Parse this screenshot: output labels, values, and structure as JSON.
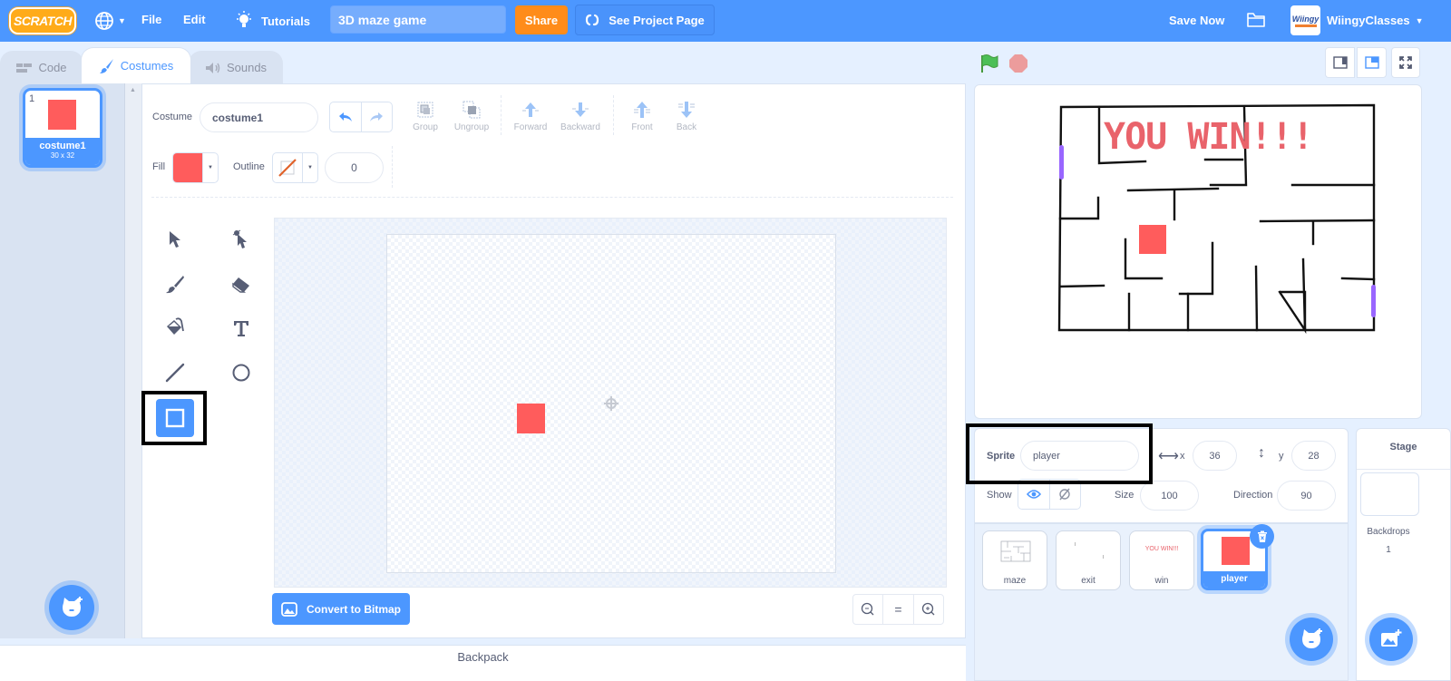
{
  "menubar": {
    "logo": "SCRATCH",
    "file": "File",
    "edit": "Edit",
    "tutorials": "Tutorials",
    "project_title": "3D maze game",
    "share": "Share",
    "see_project_page": "See Project Page",
    "save_now": "Save Now",
    "account_avatar": "Wiingy",
    "account_name": "WiingyClasses"
  },
  "tabs": [
    {
      "label": "Code",
      "icon": "code-icon",
      "active": false
    },
    {
      "label": "Costumes",
      "icon": "brush-icon",
      "active": true
    },
    {
      "label": "Sounds",
      "icon": "speaker-icon",
      "active": false
    }
  ],
  "costumes": [
    {
      "index": "1",
      "name": "costume1",
      "size": "30 x 32",
      "color": "#ff5c5c",
      "selected": true
    }
  ],
  "paint_editor": {
    "costume_label": "Costume",
    "costume_name": "costume1",
    "fill_label": "Fill",
    "fill_color": "#ff5c5c",
    "outline_label": "Outline",
    "outline_width": "0",
    "toolbar": [
      "Group",
      "Ungroup",
      "Forward",
      "Backward",
      "Front",
      "Back"
    ],
    "tools": [
      {
        "name": "select",
        "active": false
      },
      {
        "name": "reshape",
        "active": false
      },
      {
        "name": "brush",
        "active": false
      },
      {
        "name": "eraser",
        "active": false
      },
      {
        "name": "fill",
        "active": false
      },
      {
        "name": "text",
        "active": false
      },
      {
        "name": "line",
        "active": false
      },
      {
        "name": "circle",
        "active": false
      },
      {
        "name": "rectangle",
        "active": true
      }
    ],
    "convert_button": "Convert to Bitmap",
    "zoom_reset": "="
  },
  "backpack": "Backpack",
  "stage": {
    "maze_text": "YOU WIN!!!",
    "accent_purple": "#9966ff",
    "player_color": "#ff5c5c"
  },
  "sprite_info": {
    "sprite_label": "Sprite",
    "sprite_name": "player",
    "x_label": "x",
    "x_value": "36",
    "y_label": "y",
    "y_value": "28",
    "show_label": "Show",
    "size_label": "Size",
    "size_value": "100",
    "direction_label": "Direction",
    "direction_value": "90"
  },
  "sprites": [
    {
      "name": "maze",
      "selected": false
    },
    {
      "name": "exit",
      "selected": false
    },
    {
      "name": "win",
      "selected": false,
      "thumb_text": "YOU WIN!!!"
    },
    {
      "name": "player",
      "selected": true
    }
  ],
  "stage_pane": {
    "title": "Stage",
    "backdrops_label": "Backdrops",
    "backdrops_count": "1"
  }
}
